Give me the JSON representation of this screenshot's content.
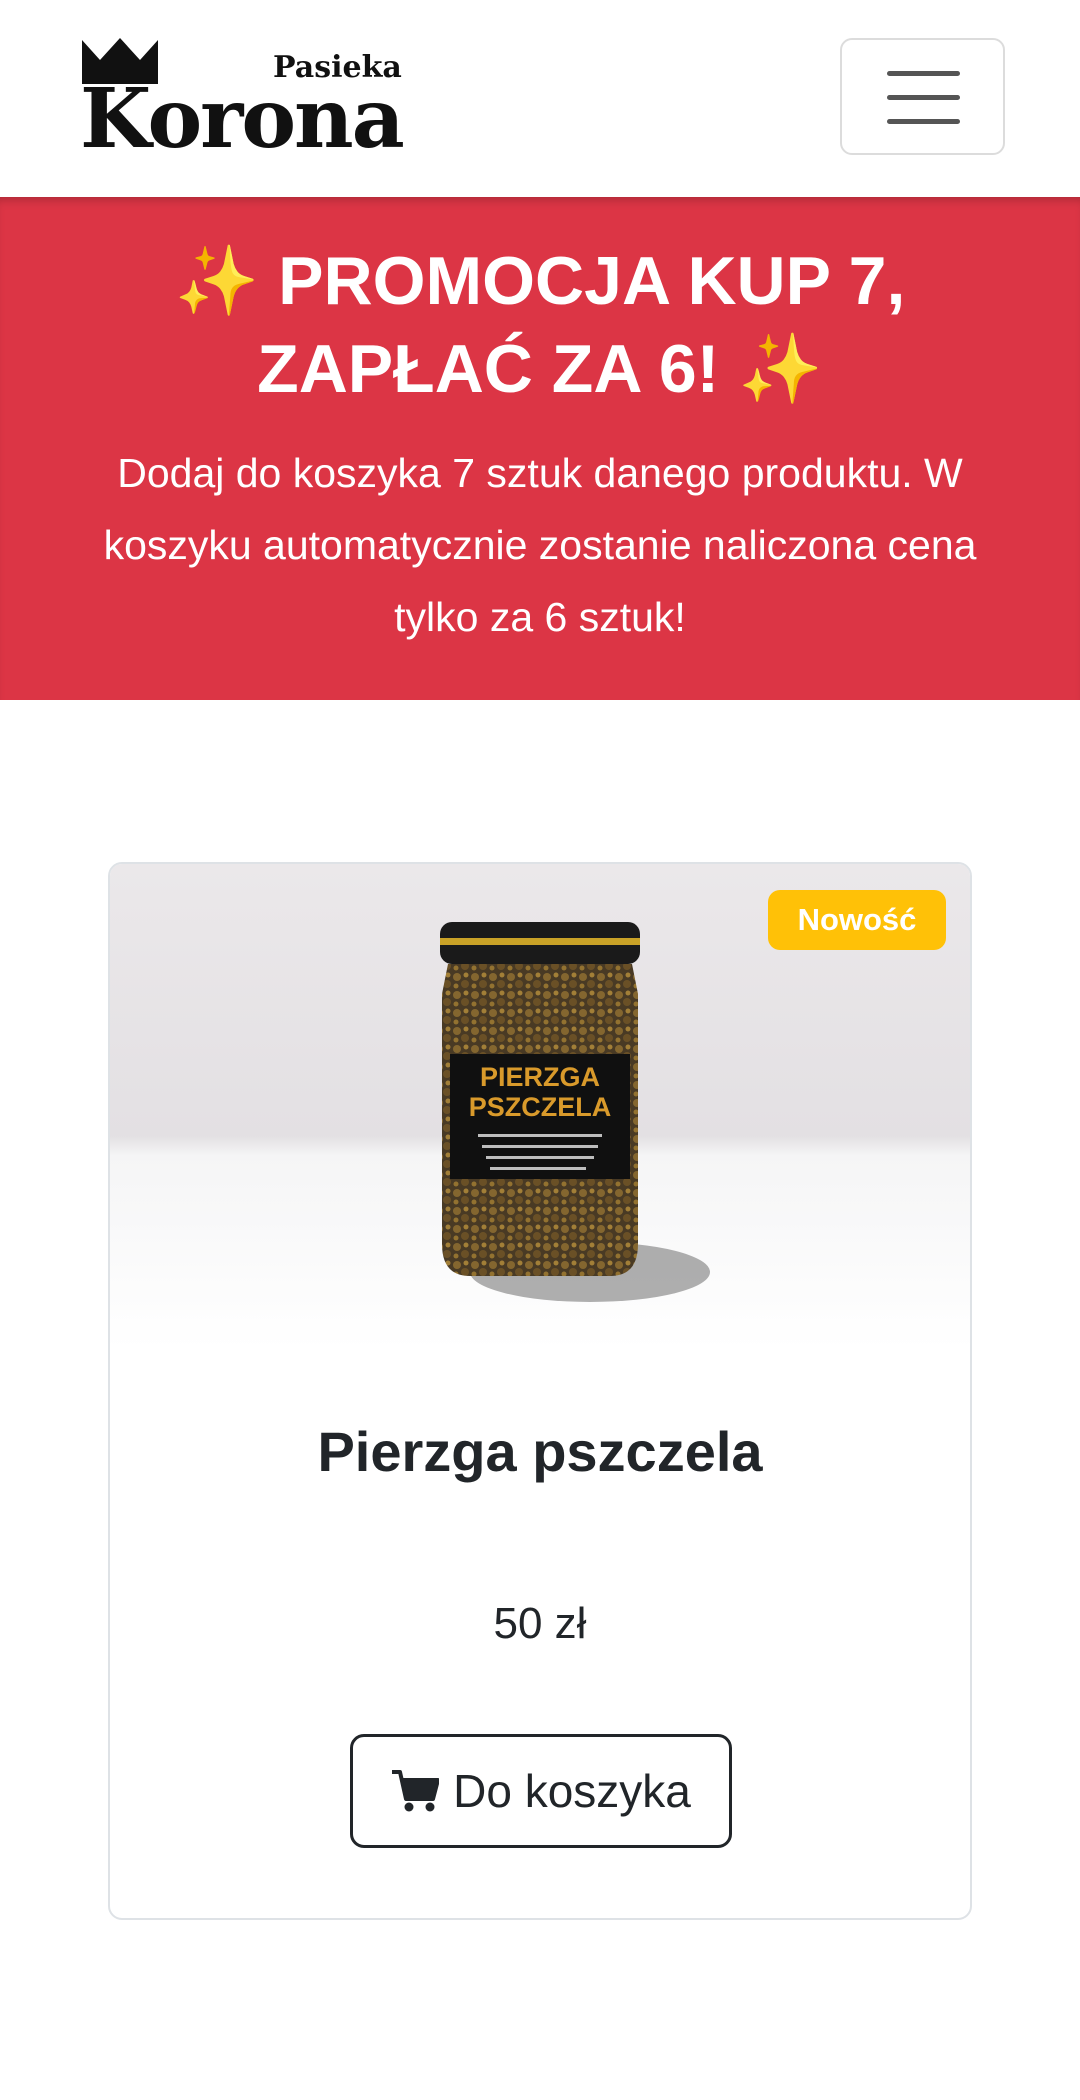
{
  "header": {
    "logo_small": "Pasieka",
    "logo_big": "Korona",
    "menu_icon": "hamburger-icon"
  },
  "promo": {
    "title": "✨ PROMOCJA KUP 7, ZAPŁAĆ ZA 6! ✨",
    "text": "Dodaj do koszyka 7 sztuk danego produktu. W koszyku automatycznie zostanie naliczona cena tylko za 6 sztuk!"
  },
  "product": {
    "badge": "Nowość",
    "name": "Pierzga pszczela",
    "price": "50 zł",
    "cart_label": "Do koszyka",
    "cart_icon": "cart-icon",
    "image_label": {
      "line1": "PIERZGA",
      "line2": "PSZCZELA"
    }
  },
  "colors": {
    "promo_bg": "#dc3545",
    "badge_bg": "#ffc107"
  }
}
